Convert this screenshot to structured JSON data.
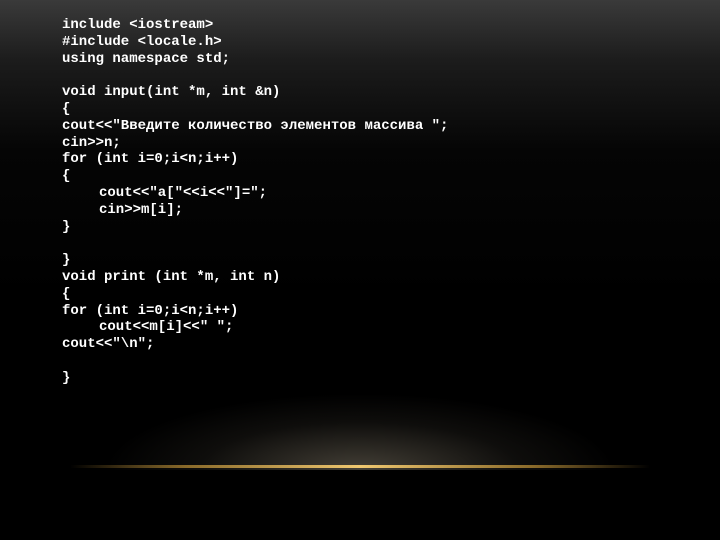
{
  "code_lines": [
    {
      "text": "include <iostream>",
      "indent": 0
    },
    {
      "text": "#include <locale.h>",
      "indent": 0
    },
    {
      "text": "using namespace std;",
      "indent": 0
    },
    {
      "text": "",
      "indent": 0
    },
    {
      "text": "void input(int *m, int &n)",
      "indent": 0
    },
    {
      "text": "{",
      "indent": 0
    },
    {
      "text": "cout<<\"Введите количество элементов массива \";",
      "indent": 0
    },
    {
      "text": "cin>>n;",
      "indent": 0
    },
    {
      "text": "for (int i=0;i<n;i++)",
      "indent": 0
    },
    {
      "text": "{",
      "indent": 0
    },
    {
      "text": "cout<<\"a[\"<<i<<\"]=\";",
      "indent": 1
    },
    {
      "text": "cin>>m[i];",
      "indent": 1
    },
    {
      "text": "}",
      "indent": 0
    },
    {
      "text": "",
      "indent": 0
    },
    {
      "text": "}",
      "indent": 0
    },
    {
      "text": "void print (int *m, int n)",
      "indent": 0
    },
    {
      "text": "{",
      "indent": 0
    },
    {
      "text": "for (int i=0;i<n;i++)",
      "indent": 0
    },
    {
      "text": "cout<<m[i]<<\" \";",
      "indent": 1
    },
    {
      "text": "cout<<\"\\n\";",
      "indent": 0
    },
    {
      "text": "",
      "indent": 0
    },
    {
      "text": "}",
      "indent": 0
    }
  ],
  "colors": {
    "text": "#ffffff",
    "background": "#000000",
    "accent_line": "#f0c870"
  }
}
